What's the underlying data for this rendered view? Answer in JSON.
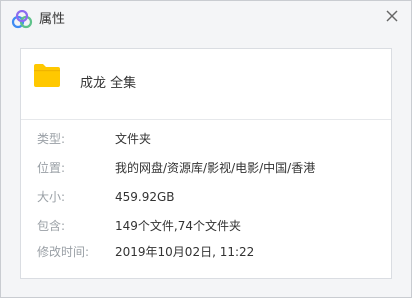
{
  "window": {
    "title": "属性",
    "app_icon": "cloud-logo-icon",
    "close_icon": "close-icon"
  },
  "item": {
    "icon": "folder-icon",
    "name": "成龙 全集"
  },
  "properties": [
    {
      "label": "类型:",
      "value": "文件夹"
    },
    {
      "label": "位置:",
      "value": "我的网盘/资源库/影视/电影/中国/香港"
    },
    {
      "label": "大小:",
      "value": "459.92GB"
    },
    {
      "label": "包含:",
      "value": "149个文件,74个文件夹"
    },
    {
      "label": "修改时间:",
      "value": "2019年10月02日, 11:22"
    }
  ],
  "colors": {
    "folder": "#ffc800",
    "logo_blue": "#3f8cf2",
    "logo_green": "#5ec28a",
    "logo_purple": "#8b6cf0"
  }
}
